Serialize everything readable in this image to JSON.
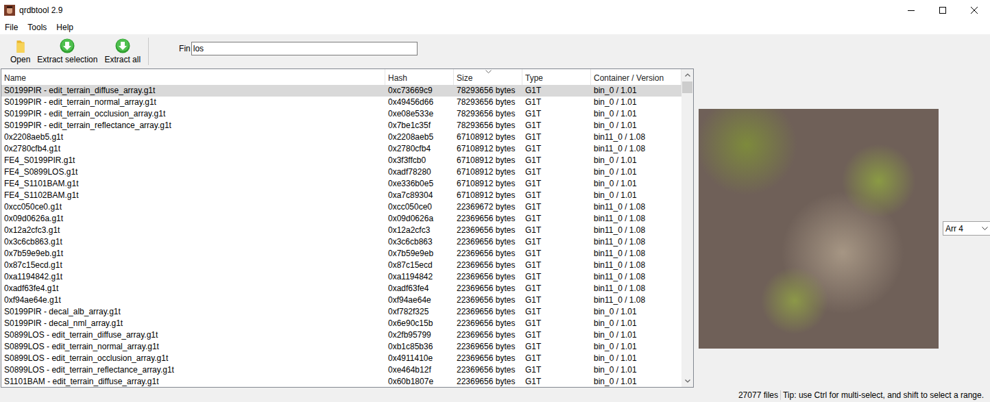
{
  "window": {
    "title": "qrdbtool 2.9"
  },
  "menu": [
    "File",
    "Tools",
    "Help"
  ],
  "toolbar": [
    {
      "label": "Open",
      "kind": "open"
    },
    {
      "label": "Extract selection",
      "kind": "extract"
    },
    {
      "label": "Extract all",
      "kind": "extract"
    }
  ],
  "search": {
    "label": "Fin",
    "value": "los"
  },
  "table": {
    "columns": [
      {
        "label": "Name",
        "sorted": false
      },
      {
        "label": "Hash",
        "sorted": false
      },
      {
        "label": "Size",
        "sorted": true
      },
      {
        "label": "Type",
        "sorted": false
      },
      {
        "label": "Container / Version",
        "sorted": false
      }
    ],
    "rows": [
      {
        "name": "S0199PIR - edit_terrain_diffuse_array.g1t",
        "hash": "0xc73669c9",
        "size": "78293656 bytes",
        "type": "G1T",
        "container": "bin_0 / 1.01",
        "selected": true
      },
      {
        "name": "S0199PIR - edit_terrain_normal_array.g1t",
        "hash": "0x49456d66",
        "size": "78293656 bytes",
        "type": "G1T",
        "container": "bin_0 / 1.01",
        "selected": false
      },
      {
        "name": "S0199PIR - edit_terrain_occlusion_array.g1t",
        "hash": "0xe08e533e",
        "size": "78293656 bytes",
        "type": "G1T",
        "container": "bin_0 / 1.01",
        "selected": false
      },
      {
        "name": "S0199PIR - edit_terrain_reflectance_array.g1t",
        "hash": "0x7be1c35f",
        "size": "78293656 bytes",
        "type": "G1T",
        "container": "bin_0 / 1.01",
        "selected": false
      },
      {
        "name": "0x2208aeb5.g1t",
        "hash": "0x2208aeb5",
        "size": "67108912 bytes",
        "type": "G1T",
        "container": "bin11_0 / 1.08",
        "selected": false
      },
      {
        "name": "0x2780cfb4.g1t",
        "hash": "0x2780cfb4",
        "size": "67108912 bytes",
        "type": "G1T",
        "container": "bin11_0 / 1.08",
        "selected": false
      },
      {
        "name": "FE4_S0199PIR.g1t",
        "hash": "0x3f3ffcb0",
        "size": "67108912 bytes",
        "type": "G1T",
        "container": "bin_0 / 1.01",
        "selected": false
      },
      {
        "name": "FE4_S0899LOS.g1t",
        "hash": "0xadf78280",
        "size": "67108912 bytes",
        "type": "G1T",
        "container": "bin_0 / 1.01",
        "selected": false
      },
      {
        "name": "FE4_S1101BAM.g1t",
        "hash": "0xe336b0e5",
        "size": "67108912 bytes",
        "type": "G1T",
        "container": "bin_0 / 1.01",
        "selected": false
      },
      {
        "name": "FE4_S1102BAM.g1t",
        "hash": "0xa7c89304",
        "size": "67108912 bytes",
        "type": "G1T",
        "container": "bin_0 / 1.01",
        "selected": false
      },
      {
        "name": "0xcc050ce0.g1t",
        "hash": "0xcc050ce0",
        "size": "22369672 bytes",
        "type": "G1T",
        "container": "bin11_0 / 1.08",
        "selected": false
      },
      {
        "name": "0x09d0626a.g1t",
        "hash": "0x09d0626a",
        "size": "22369656 bytes",
        "type": "G1T",
        "container": "bin11_0 / 1.08",
        "selected": false
      },
      {
        "name": "0x12a2cfc3.g1t",
        "hash": "0x12a2cfc3",
        "size": "22369656 bytes",
        "type": "G1T",
        "container": "bin11_0 / 1.08",
        "selected": false
      },
      {
        "name": "0x3c6cb863.g1t",
        "hash": "0x3c6cb863",
        "size": "22369656 bytes",
        "type": "G1T",
        "container": "bin11_0 / 1.08",
        "selected": false
      },
      {
        "name": "0x7b59e9eb.g1t",
        "hash": "0x7b59e9eb",
        "size": "22369656 bytes",
        "type": "G1T",
        "container": "bin11_0 / 1.08",
        "selected": false
      },
      {
        "name": "0x87c15ecd.g1t",
        "hash": "0x87c15ecd",
        "size": "22369656 bytes",
        "type": "G1T",
        "container": "bin11_0 / 1.08",
        "selected": false
      },
      {
        "name": "0xa1194842.g1t",
        "hash": "0xa1194842",
        "size": "22369656 bytes",
        "type": "G1T",
        "container": "bin11_0 / 1.08",
        "selected": false
      },
      {
        "name": "0xadf63fe4.g1t",
        "hash": "0xadf63fe4",
        "size": "22369656 bytes",
        "type": "G1T",
        "container": "bin11_0 / 1.08",
        "selected": false
      },
      {
        "name": "0xf94ae64e.g1t",
        "hash": "0xf94ae64e",
        "size": "22369656 bytes",
        "type": "G1T",
        "container": "bin11_0 / 1.08",
        "selected": false
      },
      {
        "name": "S0199PIR - decal_alb_array.g1t",
        "hash": "0xf782f325",
        "size": "22369656 bytes",
        "type": "G1T",
        "container": "bin_0 / 1.01",
        "selected": false
      },
      {
        "name": "S0199PIR - decal_nml_array.g1t",
        "hash": "0x6e90c15b",
        "size": "22369656 bytes",
        "type": "G1T",
        "container": "bin_0 / 1.01",
        "selected": false
      },
      {
        "name": "S0899LOS - edit_terrain_diffuse_array.g1t",
        "hash": "0x2fb95799",
        "size": "22369656 bytes",
        "type": "G1T",
        "container": "bin_0 / 1.01",
        "selected": false
      },
      {
        "name": "S0899LOS - edit_terrain_normal_array.g1t",
        "hash": "0xb1c85b36",
        "size": "22369656 bytes",
        "type": "G1T",
        "container": "bin_0 / 1.01",
        "selected": false
      },
      {
        "name": "S0899LOS - edit_terrain_occlusion_array.g1t",
        "hash": "0x4911410e",
        "size": "22369656 bytes",
        "type": "G1T",
        "container": "bin_0 / 1.01",
        "selected": false
      },
      {
        "name": "S0899LOS - edit_terrain_reflectance_array.g1t",
        "hash": "0xe464b12f",
        "size": "22369656 bytes",
        "type": "G1T",
        "container": "bin_0 / 1.01",
        "selected": false
      },
      {
        "name": "S1101BAM - edit_terrain_diffuse_array.g1t",
        "hash": "0x60b1807e",
        "size": "22369656 bytes",
        "type": "G1T",
        "container": "bin_0 / 1.01",
        "selected": false
      }
    ]
  },
  "preview": {
    "selector": "Arr 4"
  },
  "status_bar": {
    "count": "27077 files",
    "tip": "Tip: use Ctrl for multi-select, and shift to select a range."
  }
}
